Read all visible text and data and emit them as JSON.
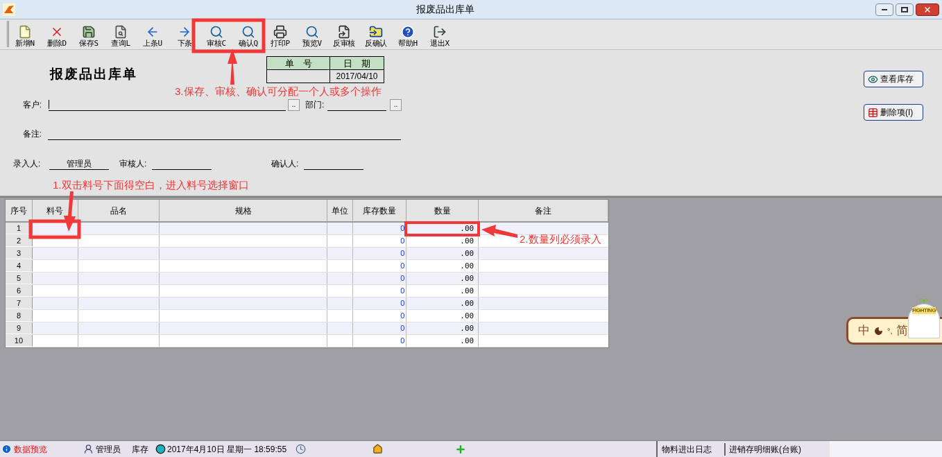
{
  "window": {
    "title": "报废品出库单"
  },
  "toolbar": [
    {
      "label": "新增N",
      "kind": "new"
    },
    {
      "label": "删除D",
      "kind": "delete"
    },
    {
      "label": "保存S",
      "kind": "save"
    },
    {
      "label": "查询L",
      "kind": "query"
    },
    {
      "label": "上条U",
      "kind": "prev"
    },
    {
      "label": "下条",
      "kind": "next"
    },
    {
      "label": "审核C",
      "kind": "search"
    },
    {
      "label": "确认Q",
      "kind": "search"
    },
    {
      "label": "打印P",
      "kind": "print"
    },
    {
      "label": "预览V",
      "kind": "search"
    },
    {
      "label": "反审核",
      "kind": "unreview"
    },
    {
      "label": "反确认",
      "kind": "unconfirm"
    },
    {
      "label": "帮助H",
      "kind": "help"
    },
    {
      "label": "退出X",
      "kind": "exit"
    }
  ],
  "form": {
    "title": "报废品出库单",
    "doc_number_label": "单　号",
    "date_label": "日　期",
    "date": "2017/04/10",
    "customer_label": "客户:",
    "browse": "..",
    "dept_label": "部门:",
    "remark_label": "备注:",
    "entered_by_label": "录入人:",
    "entered_by": "管理员",
    "reviewer_label": "审核人:",
    "confirmer_label": "确认人:"
  },
  "side_buttons": [
    {
      "label": "查看库存",
      "kind": "stock"
    },
    {
      "label": "删除项(I)",
      "kind": "delete"
    }
  ],
  "table": {
    "columns": [
      "序号",
      "料号",
      "品名",
      "规格",
      "单位",
      "库存数量",
      "数量",
      "备注"
    ],
    "rows": [
      {
        "no": "1",
        "stock": "0",
        "qty": ".00"
      },
      {
        "no": "2",
        "stock": "0",
        "qty": ".00"
      },
      {
        "no": "3",
        "stock": "0",
        "qty": ".00"
      },
      {
        "no": "4",
        "stock": "0",
        "qty": ".00"
      },
      {
        "no": "5",
        "stock": "0",
        "qty": ".00"
      },
      {
        "no": "6",
        "stock": "0",
        "qty": ".00"
      },
      {
        "no": "7",
        "stock": "0",
        "qty": ".00"
      },
      {
        "no": "8",
        "stock": "0",
        "qty": ".00"
      },
      {
        "no": "9",
        "stock": "0",
        "qty": ".00"
      },
      {
        "no": "10",
        "stock": "0",
        "qty": ".00"
      }
    ]
  },
  "annotations": [
    {
      "text": "3.保存、审核、确认可分配一个人或多个操作",
      "kind": "toolbar"
    },
    {
      "text": "1.双击料号下面得空白，进入料号选择窗口",
      "kind": "item"
    },
    {
      "text": "2.数量列必须录入",
      "kind": "qty"
    }
  ],
  "ime": {
    "lang": "中",
    "punct": "°,",
    "mode": "简",
    "mascot": "FIGHTING"
  },
  "status_bar": {
    "mode": "数据预览",
    "user": "管理员",
    "module": "库存",
    "datetime": "2017年4月10日 星期一 18:59:55",
    "log": "物料进出日志",
    "ledger": "进销存明细账(台账)"
  }
}
